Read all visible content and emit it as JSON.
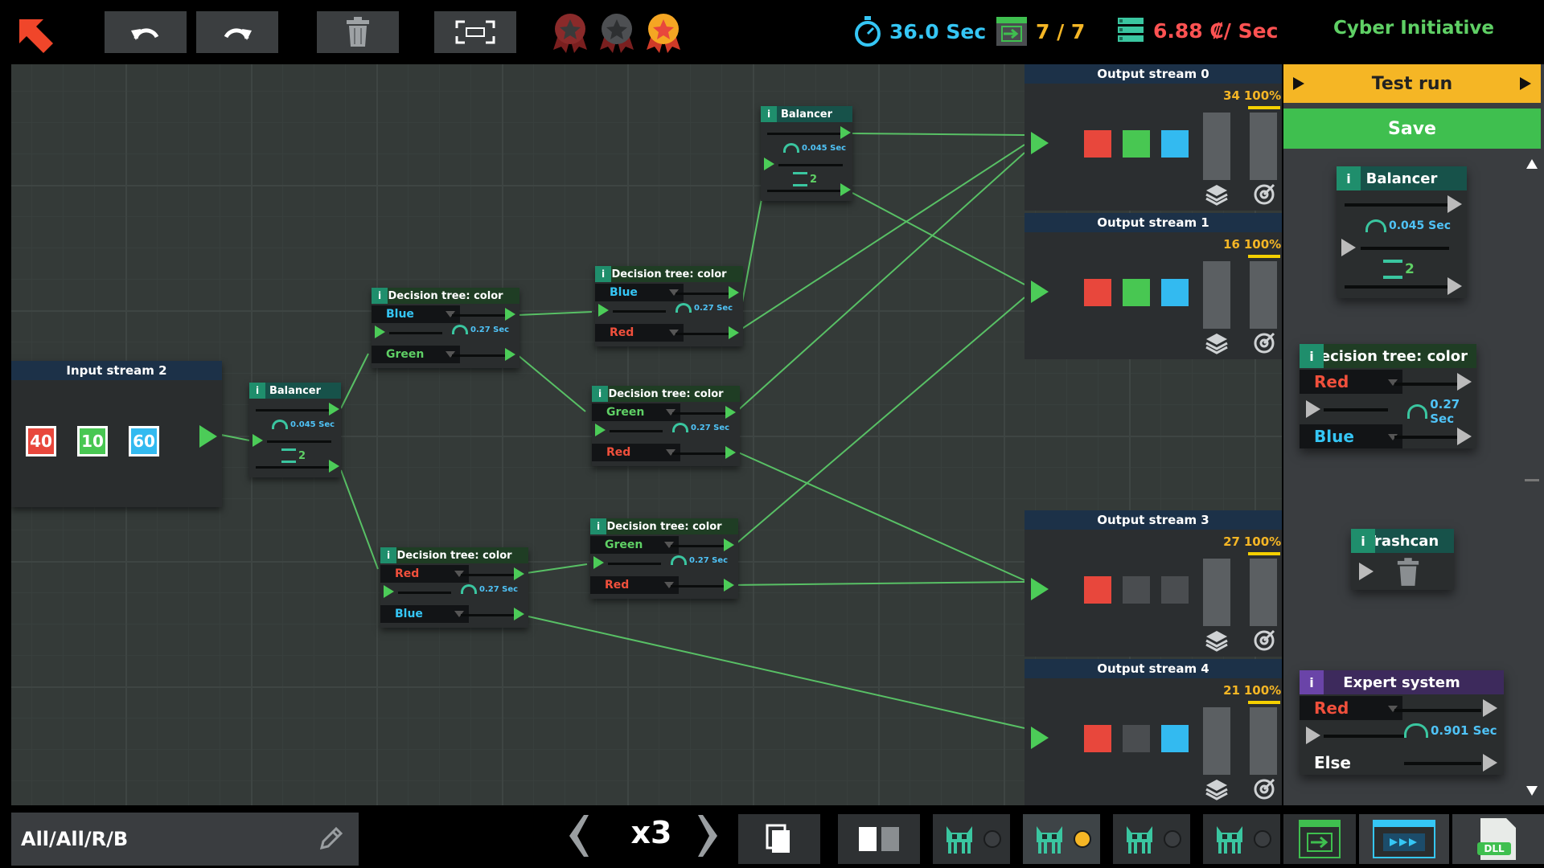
{
  "topbar": {
    "back_icon": "arrow-up-left-icon",
    "undo_icon": "undo-icon",
    "redo_icon": "redo-icon",
    "delete_icon": "trashcan-icon",
    "fit_icon": "fit-screen-icon",
    "medals": [
      "bronze-medal-icon",
      "silver-medal-icon",
      "gold-medal-icon"
    ],
    "time": "36.0 Sec",
    "streams": "7 / 7",
    "cost": "6.88 ₡/ Sec",
    "company": "Cyber Initiative"
  },
  "input_stream": {
    "title": "Input stream 2",
    "counts": [
      {
        "value": "40",
        "color": "#e8473c"
      },
      {
        "value": "10",
        "color": "#48c752"
      },
      {
        "value": "60",
        "color": "#33baf0"
      }
    ]
  },
  "nodes": {
    "balancer_1": {
      "title": "Balancer",
      "info": "i",
      "time": "0.045 Sec",
      "outputs": "2"
    },
    "balancer_2": {
      "title": "Balancer",
      "info": "i",
      "time": "0.045 Sec",
      "outputs": "2"
    },
    "dt_1": {
      "title": "Decision tree: color",
      "info": "i",
      "top": "Blue",
      "bottom": "Green",
      "time": "0.27 Sec"
    },
    "dt_2": {
      "title": "Decision tree: color",
      "info": "i",
      "top": "Red",
      "bottom": "Blue",
      "time": "0.27 Sec"
    },
    "dt_3": {
      "title": "Decision tree: color",
      "info": "i",
      "top": "Blue",
      "bottom": "Red",
      "time": "0.27 Sec"
    },
    "dt_4": {
      "title": "Decision tree: color",
      "info": "i",
      "top": "Green",
      "bottom": "Red",
      "time": "0.27 Sec"
    },
    "dt_5": {
      "title": "Decision tree: color",
      "info": "i",
      "top": "Green",
      "bottom": "Red",
      "time": "0.27 Sec"
    }
  },
  "outputs": [
    {
      "title": "Output stream 0",
      "count": "34",
      "percent": "100%",
      "colors": [
        "#e8473c",
        "#48c752",
        "#33baf0"
      ]
    },
    {
      "title": "Output stream 1",
      "count": "16",
      "percent": "100%",
      "colors": [
        "#e8473c",
        "#48c752",
        "#33baf0"
      ]
    },
    {
      "title": "Output stream 3",
      "count": "27",
      "percent": "100%",
      "colors": [
        "#e8473c",
        "#4a4d50",
        "#4a4d50"
      ]
    },
    {
      "title": "Output stream 4",
      "count": "21",
      "percent": "100%",
      "colors": [
        "#e8473c",
        "#4a4d50",
        "#33baf0"
      ]
    }
  ],
  "panel": {
    "test_run": "Test run",
    "save": "Save",
    "balancer": {
      "title": "Balancer",
      "info": "i",
      "time": "0.045 Sec",
      "outputs": "2"
    },
    "decision_tree": {
      "title": "Decision tree: color",
      "info": "i",
      "top": "Red",
      "bottom": "Blue",
      "time": "0.27 Sec"
    },
    "trashcan": {
      "title": "Trashcan",
      "info": "i"
    },
    "expert": {
      "title": "Expert system",
      "info": "i",
      "top": "Red",
      "bottom": "Else",
      "time": "0.901 Sec"
    }
  },
  "bottombar": {
    "filter": "All/All/R/B",
    "speed": "x3",
    "prev_icon": "chevron-left-icon",
    "next_icon": "chevron-right-icon",
    "bot_slots": [
      "bot-icon",
      "bot-icon",
      "bot-icon",
      "bot-icon"
    ],
    "active_slot": 1,
    "dll_label": "DLL"
  },
  "colors": {
    "accent_green": "#4ccc58",
    "test_run": "#f5b625",
    "save": "#3fbf4f",
    "wire": "#5ccf6a"
  }
}
